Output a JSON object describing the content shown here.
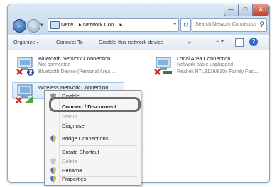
{
  "address": {
    "path": "Netw... ▸ Network Con... ▸",
    "search_placeholder": "Search Network Connections"
  },
  "toolbar": {
    "organize": "Organize",
    "connect_to": "Connect To",
    "disable_device": "Disable this network device",
    "more": "»"
  },
  "connections": [
    {
      "name": "Bluetooth Network Connection",
      "status": "Not connected",
      "device": "Bluetooth Device (Personal Area ..."
    },
    {
      "name": "Local Area Connection",
      "status": "Network cable unplugged",
      "device": "Realtek RTL8139/810x Family Fast..."
    },
    {
      "name": "Wireless Network Connection",
      "status": "",
      "device": ""
    }
  ],
  "context_menu": {
    "items": [
      {
        "label": "Disable",
        "disabled": false,
        "bold": false,
        "icon": "shield-icon"
      },
      {
        "label": "Connect / Disconnect",
        "disabled": false,
        "bold": true,
        "icon": ""
      },
      {
        "label": "Status",
        "disabled": true,
        "bold": false,
        "icon": ""
      },
      {
        "label": "Diagnose",
        "disabled": false,
        "bold": false,
        "icon": ""
      },
      {
        "label": "Bridge Connections",
        "disabled": false,
        "bold": false,
        "icon": "shield-icon"
      },
      {
        "label": "Create Shortcut",
        "disabled": false,
        "bold": false,
        "icon": ""
      },
      {
        "label": "Delete",
        "disabled": true,
        "bold": false,
        "icon": "shield-icon"
      },
      {
        "label": "Rename",
        "disabled": false,
        "bold": false,
        "icon": "shield-icon"
      },
      {
        "label": "Properties",
        "disabled": false,
        "bold": false,
        "icon": "shield-icon"
      }
    ]
  },
  "colors": {
    "title_gradient_top": "#dbe8f5",
    "selection": "#d7e7f8",
    "close_button": "#c6402c",
    "highlight_ring": "#6a6a6a"
  }
}
